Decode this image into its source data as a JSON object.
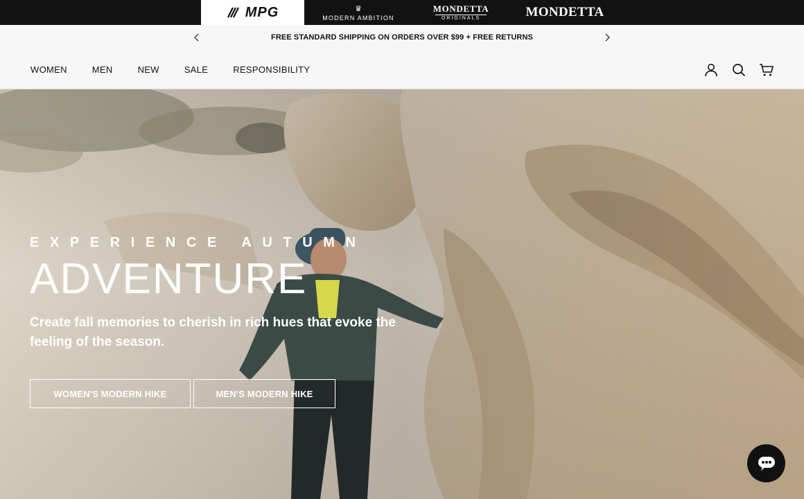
{
  "brands": {
    "mpg": "MPG",
    "modern_ambition": "MODERN AMBITION",
    "mondetta_originals_word": "MONDETTA",
    "mondetta_originals_sub": "ORIGINALS",
    "mondetta": "MONDETTA"
  },
  "announcement": {
    "text": "FREE STANDARD SHIPPING ON ORDERS OVER $99 + FREE RETURNS",
    "prev_icon": "chevron-left-icon",
    "next_icon": "chevron-right-icon"
  },
  "nav": {
    "links": [
      "WOMEN",
      "MEN",
      "NEW",
      "SALE",
      "RESPONSIBILITY"
    ],
    "icons": [
      "account-icon",
      "search-icon",
      "cart-icon"
    ]
  },
  "hero": {
    "eyebrow": "EXPERIENCE AUTUMN",
    "headline": "ADVENTURE",
    "subtext": "Create fall memories to cherish in rich hues that evoke the feeling of the season.",
    "cta_women": "WOMEN'S MODERN HIKE",
    "cta_men": "MEN'S MODERN HIKE"
  },
  "chat": {
    "icon": "chat-icon"
  }
}
